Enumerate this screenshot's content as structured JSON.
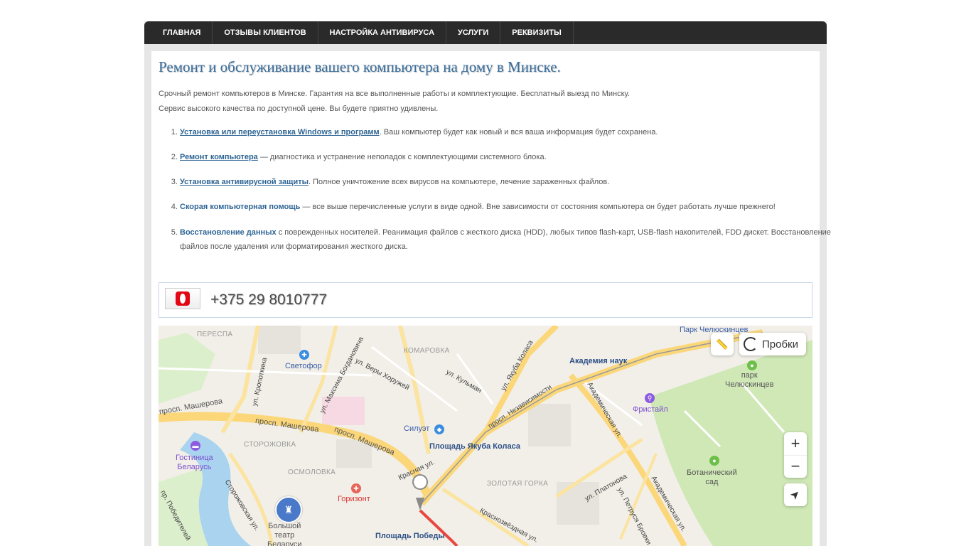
{
  "nav": {
    "items": [
      "ГЛАВНАЯ",
      "ОТЗЫВЫ КЛИЕНТОВ",
      "НАСТРОЙКА АНТИВИРУСА",
      "УСЛУГИ",
      "РЕКВИЗИТЫ"
    ]
  },
  "page": {
    "title": "Ремонт и обслуживание вашего компьютера на дому в Минске.",
    "intro1": "Срочный ремонт компьютеров в Минске. Гарантия на все выполненные работы и комплектующие. Бесплатный выезд по Минску.",
    "intro2": "Сервис высокого качества по доступной цене. Вы будете приятно удивлены."
  },
  "services": [
    {
      "link": "Установка или переустановка Windows и программ",
      "text": ". Ваш компьютер будет как новый и вся ваша информация будет сохранена."
    },
    {
      "link": "Ремонт компьютера",
      "text": " — диагностика и устранение неполадок с комплектующими системного блока."
    },
    {
      "link": "Установка антивирусной защиты",
      "text": ". Полное уничтожение всех вирусов на компьютере, лечение зараженных файлов."
    },
    {
      "link": "Скорая компьютерная помощь",
      "text": " — все выше перечисленные услуги в виде одной. Вне зависимости от состояния компьютера он будет работать лучше прежнего!"
    },
    {
      "link": "Восстановление данных",
      "text": " с поврежденных носителей. Реанимация файлов с жесткого диска (HDD), любых типов flash-карт, USB-flash накопителей, FDD дискет. Восстановление файлов после удаления или форматирования жесткого диска."
    }
  ],
  "contact": {
    "phone": "+375 29 8010777",
    "operator_icon": "mts-logo-icon"
  },
  "map": {
    "traffic_label": "Пробки",
    "labels": {
      "park_chelyuskintsev": "Парк Челюскинцев",
      "akademia_nauk": "Академия наук",
      "park_chel": "парк\nЧелюскинцев",
      "fristail": "Фристайл",
      "botanic": "Ботанический\nсад",
      "svetofor": "Светофор",
      "siluet": "Силуэт",
      "ploshchad_kolasa": "Площадь Якуба Коласа",
      "gostinica": "Гостиница\nБеларусь",
      "gorizont": "Горизонт",
      "ploshchad_pobedy": "Площадь Победы",
      "teatr": "Большой\nтеатр\nБеларуси",
      "perespa": "ПЕРЕСПА",
      "komarovka": "КОМАРОВКА",
      "storozhovka": "СТОРОЖОВКА",
      "osmolovka": "ОСМОЛОВКА",
      "zolotaya_gorka": "ЗОЛОТАЯ ГОРКА",
      "masherova1": "просп. Машерова",
      "masherova2": "просп. Машерова",
      "masherova3": "просп. Машерова",
      "nezavisimosti": "просп. Независимости",
      "kolasa": "ул. Якуба Коласа",
      "kulman": "ул. Кульман",
      "very_khoruzhey": "ул. Веры Хоружей",
      "bogdanovicha": "ул. Максима Богдановича",
      "kropotkina": "ул. Кропоткина",
      "krasnaya": "Красная ул.",
      "akademicheskaya1": "Академическая ул.",
      "akademicheskaya2": "Академическая ул.",
      "platonova": "ул. Платонова",
      "brovki": "ул. Петруся Бровки",
      "storozhevskaya": "Сторожовская ул.",
      "pobediteley": "пр. Победителей",
      "krasnozvezdnaya": "Краснозвёздная ул."
    }
  }
}
